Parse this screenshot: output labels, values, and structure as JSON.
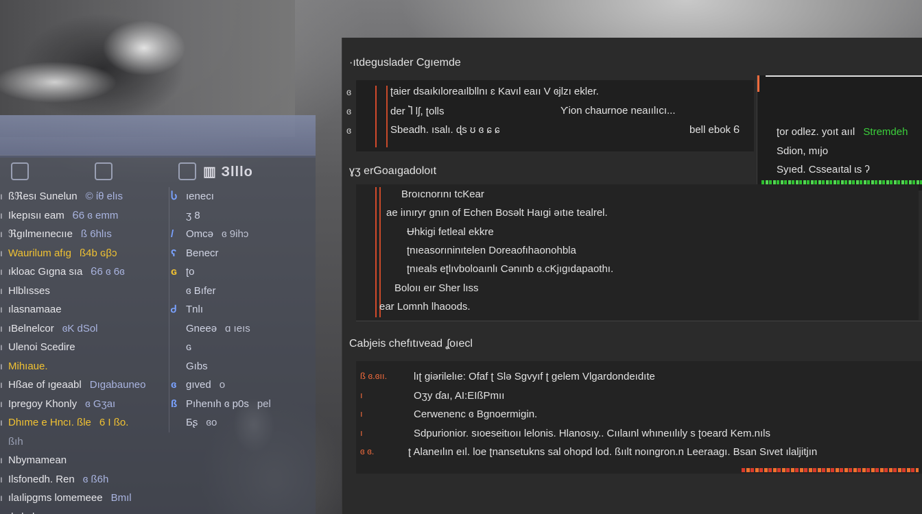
{
  "left": {
    "tab_label": "▥ Зlllo",
    "rows": [
      {
        "num": "ı",
        "label": "ßℜesı Sunelun",
        "value": "© ίθ elıs",
        "style": ""
      },
      {
        "num": "ı",
        "label": "Ikepısıı eam",
        "value": "Ꮾ6 ɞ emm",
        "style": ""
      },
      {
        "num": "ı",
        "label": "ℜgılmeınecııe",
        "value": "ß 6hlıs",
        "style": ""
      },
      {
        "num": "ı",
        "label": "Waurilum afıg",
        "value": "ß4b ɢβɔ",
        "style": "yellow"
      },
      {
        "num": "ı",
        "label": "ıkloac Gıgna sıa",
        "value": "Ꮾ6 ɞ 6ɞ",
        "style": ""
      },
      {
        "num": "ı",
        "label": "Hlblısses",
        "value": "",
        "style": ""
      },
      {
        "num": "ı",
        "label": "ılasnamaae",
        "value": "",
        "style": ""
      },
      {
        "num": "ı",
        "label": "ıBelnelcor",
        "value": "ɞK dSol",
        "style": ""
      },
      {
        "num": "ı",
        "label": "Ulenoi Scedire",
        "value": "",
        "style": ""
      },
      {
        "num": "ı",
        "label": "Mihıaue.",
        "value": "",
        "style": "yellow"
      },
      {
        "num": "ı",
        "label": "Hßae of ıgeaabl",
        "value": "Dıgabauneo",
        "style": ""
      },
      {
        "num": "ı",
        "label": "Ipregoy Khonly",
        "value": "ɞ Gʒaı",
        "style": ""
      },
      {
        "num": "ı",
        "label": "Dhıme e Hncı. ßle",
        "value": "6 I ßo.",
        "style": "yellow"
      },
      {
        "num": "",
        "label": "ßıh",
        "value": "",
        "style": "dim"
      },
      {
        "num": "ı",
        "label": "Nbymamean",
        "value": "",
        "style": ""
      },
      {
        "num": "ı",
        "label": "Ilsfonedh. Ren",
        "value": "ɞ ß6h",
        "style": ""
      },
      {
        "num": "ı",
        "label": "ılaılipgms lomemeee",
        "value": "Bmıl",
        "style": ""
      },
      {
        "num": "ı",
        "label": "ılıslgılı eo oıy",
        "value": "",
        "style": ""
      }
    ],
    "mid_rows": [
      {
        "icon": "Ⴑ",
        "label": "ıenecı",
        "value": "",
        "style": ""
      },
      {
        "icon": "",
        "label": "ʒ 8",
        "value": "",
        "style": ""
      },
      {
        "icon": "/",
        "label": "Omcə",
        "value": "ɞ 9ihɔ",
        "style": ""
      },
      {
        "icon": "ʕ",
        "label": "Benecr",
        "value": "",
        "style": ""
      },
      {
        "icon": "ɢ",
        "label": "ʈo",
        "value": "",
        "style": "yellow"
      },
      {
        "icon": "",
        "label": "ɞ Bıfer",
        "value": "",
        "style": ""
      },
      {
        "icon": "Ꮷ",
        "label": "Tnlı",
        "value": "",
        "style": ""
      },
      {
        "icon": "",
        "label": "Gneeə",
        "value": "ɑ ıeıs",
        "style": ""
      },
      {
        "icon": "",
        "label": "ɢ",
        "value": "",
        "style": ""
      },
      {
        "icon": "",
        "label": "Gıbs",
        "value": "",
        "style": ""
      },
      {
        "icon": "ɞ",
        "label": "gıved",
        "value": "o",
        "style": ""
      },
      {
        "icon": "ß",
        "label": "Pıhenıh ɞ p0s",
        "value": "pel",
        "style": ""
      },
      {
        "icon": "",
        "label": "Бʂ",
        "value": "ɞo",
        "style": ""
      }
    ]
  },
  "console": {
    "section1_title": "·ıtdeguslader Cgıemde",
    "section1_lines": [
      {
        "gutter": "ɞ",
        "text": "ʈaier dsaıkıloreaılbllnı ɛ Kavıl eaıı V ɞjlzı ekler.",
        "tail": ""
      },
      {
        "gutter": "ɞ",
        "text": "der Ⴈ lʃ, ʈolls",
        "tail": "Ƴion chaurnoe neaıılıcı..."
      },
      {
        "gutter": "ɞ",
        "text": "Sbeadh.    ısalı. ɖs  ʊ  ɞ  ɕ  ɕ",
        "tail": "bell ebok  Ꮾ"
      }
    ],
    "side_lines": [
      "ʈor odlez. yoıt aııl",
      "Sdion, mıjo",
      "Syıed. Csseaıtal  ɩs ʔ"
    ],
    "side_green": "Stremdeh",
    "section2_title": "ɣʒ erGoaıgadoloıt",
    "section2_lines": [
      "Broıcnorını tcKear",
      "ae iınıryr gnın of Echen Bosəlt Haıgi əıtıe tealrel.",
      "Ʉhkigi fetleal ekkre",
      "ʈnıeasorıninıtelen Doreaofıhaonohbla",
      "ʈnıeals eʈlıvboloaınlı Cənınb ɞ.cKjıgıdapaothı.",
      "Boloıı eır Sher lıss",
      "ear Lomnh lhaoods."
    ],
    "section3_title": "Cabjeis chefıtıvead ʆoıecl",
    "section3_lines": [
      {
        "lead": "ß ɞ.ɞıı.",
        "text": "lıʈ giərilelıe: Ofaf ʈ Slə Sgvyıf ʈ gelem Vlgardondeıdıte"
      },
      {
        "lead": "ı",
        "text": "Oʒy ɗaı, AI:EIßPmıı"
      },
      {
        "lead": "ı",
        "text": "Cerwenenc ɞ Bgnoermigin."
      },
      {
        "lead": "ı",
        "text": "Sdpurionior. sıoeseitıoıı lelonis. Hlanosıy.. Cıılaınl whıneıılıly s ʈoeard Kem.nıls"
      },
      {
        "lead": "ɞ ɞ.",
        "text": "ʈ Alaneılın eıl. loe ʈnansetukns sal ohopd lod. ßıılt noıngron.n Leeraagı. Bsan Sıvet ılaljitjın"
      }
    ]
  }
}
